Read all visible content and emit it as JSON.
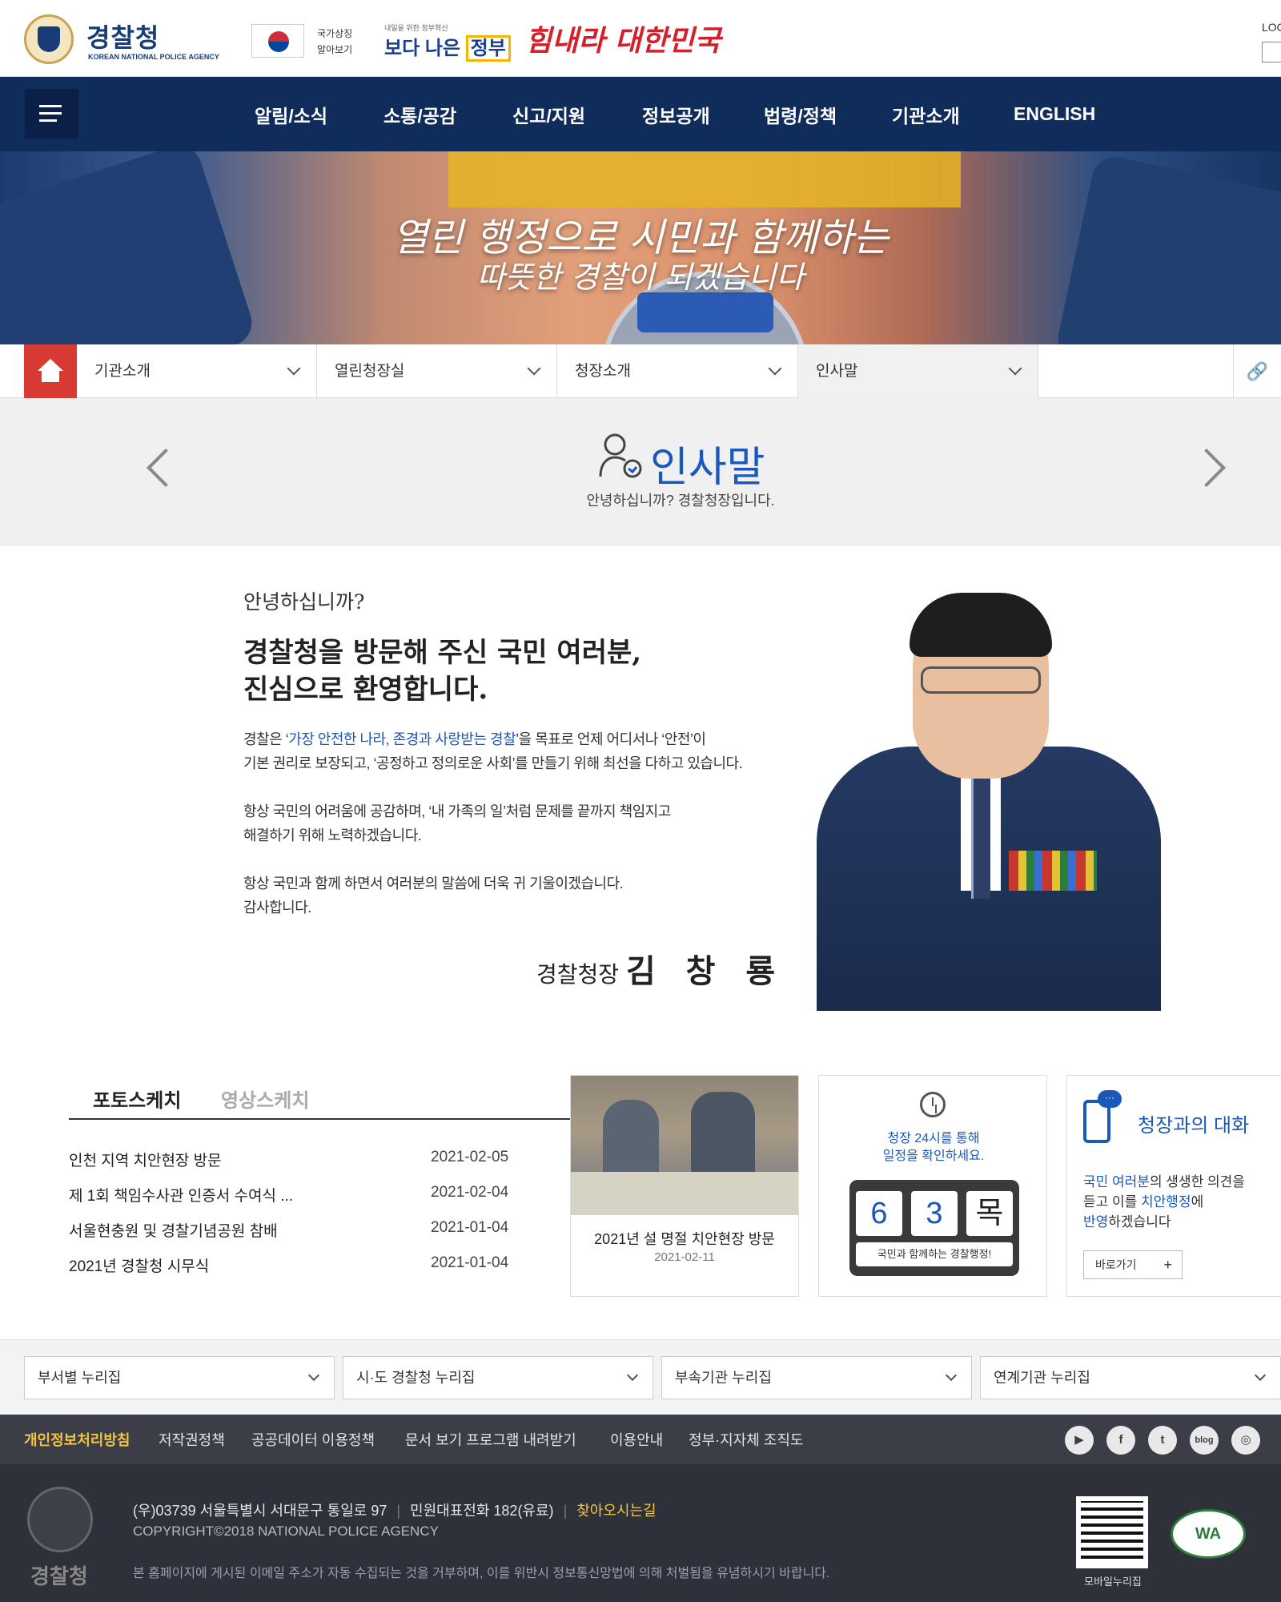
{
  "header": {
    "logo_title": "경찰청",
    "logo_sub": "KOREAN NATIONAL POLICE AGENCY",
    "flag_text_1": "국가상징",
    "flag_text_2": "알아보기",
    "gov_small": "내일을 위한 정부혁신",
    "gov_main": "보다 나은",
    "gov_main_box": "정부",
    "slogan": "힘내라 대한민국",
    "login": "LOG"
  },
  "nav": {
    "items": [
      "알림/소식",
      "소통/공감",
      "신고/지원",
      "정보공개",
      "법령/정책",
      "기관소개",
      "ENGLISH"
    ]
  },
  "banner": {
    "line1": "열린 행정으로 시민과 함께하는",
    "line2": "따뜻한 경찰이 되겠습니다"
  },
  "breadcrumb": {
    "items": [
      "기관소개",
      "열린청장실",
      "청장소개",
      "인사말"
    ]
  },
  "page": {
    "title": "인사말",
    "subtitle": "안녕하십니까? 경찰청장입니다."
  },
  "greeting": {
    "hello": "안녕하십니까?",
    "head1": "경찰청을 방문해 주신 국민 여러분,",
    "head2": "진심으로 환영합니다.",
    "p1_a": "경찰은 ‘",
    "p1_hl": "가장 안전한 나라, 존경과 사랑받는 경찰",
    "p1_b": "’을 목표로 언제 어디서나 ‘안전’이",
    "p1_c": "기본 권리로 보장되고, ‘공정하고 정의로운 사회’를 만들기 위해 최선을 다하고 있습니다.",
    "p2_a": "항상 국민의 어려움에 공감하며, ‘내 가족의 일’처럼 문제를 끝까지 책임지고",
    "p2_b": "해결하기 위해 노력하겠습니다.",
    "p3_a": "항상 국민과 함께 하면서 여러분의 말씀에 더욱 귀 기울이겠습니다.",
    "p3_b": "감사합니다.",
    "sig_title": "경찰청장",
    "sig_name": "김 창 룡"
  },
  "tabs": {
    "active": "포토스케치",
    "inactive": "영상스케치"
  },
  "news": [
    {
      "title": "인천 지역 치안현장 방문",
      "date": "2021-02-05"
    },
    {
      "title": "제 1회 책임수사관 인증서 수여식 ...",
      "date": "2021-02-04"
    },
    {
      "title": "서울현충원 및 경찰기념공원 참배",
      "date": "2021-01-04"
    },
    {
      "title": "2021년 경찰청 시무식",
      "date": "2021-01-04"
    }
  ],
  "photo": {
    "caption": "2021년 설 명절 치안현장 방문",
    "date": "2021-02-11"
  },
  "schedule": {
    "line1": "청장 24시를 통해",
    "line2": "일정을 확인하세요.",
    "month": "6",
    "day": "3",
    "weekday": "목",
    "footer": "국민과 함께하는 경찰행정!"
  },
  "talk": {
    "bubble": "···",
    "title": "청장과의 대화",
    "p_a_hl": "국민 여러분",
    "p_a": "의 생생한 의견을",
    "p_b_a": "듣고 이를 ",
    "p_b_hl": "치안행정",
    "p_b_b": "에",
    "p_c_hl": "반영",
    "p_c": "하겠습니다",
    "button": "바로가기",
    "button_plus": "+"
  },
  "family_sites": [
    "부서별 누리집",
    "시·도 경찰청 누리집",
    "부속기관 누리집",
    "연계기관 누리집"
  ],
  "footer_links": [
    "개인정보처리방침",
    "저작권정책",
    "공공데이터 이용정책",
    "문서 보기 프로그램 내려받기",
    "이용안내",
    "정부·지자체 조직도"
  ],
  "social": [
    "▶",
    "f",
    "t",
    "blog",
    "◎"
  ],
  "footer": {
    "name": "경찰청",
    "address": "(우)03739 서울특별시 서대문구 통일로 97",
    "phone": "민원대표전화 182(유료)",
    "directions": "찾아오시는길",
    "copyright": "COPYRIGHT©2018 NATIONAL POLICE AGENCY",
    "notice": "본 홈페이지에 게시된 이메일 주소가 자동 수집되는 것을 거부하며, 이를 위반시 정보통신망법에 의해 처벌됨을 유념하시기 바랍니다.",
    "qr_label": "모바일누리집",
    "wa_mark": "WA"
  }
}
